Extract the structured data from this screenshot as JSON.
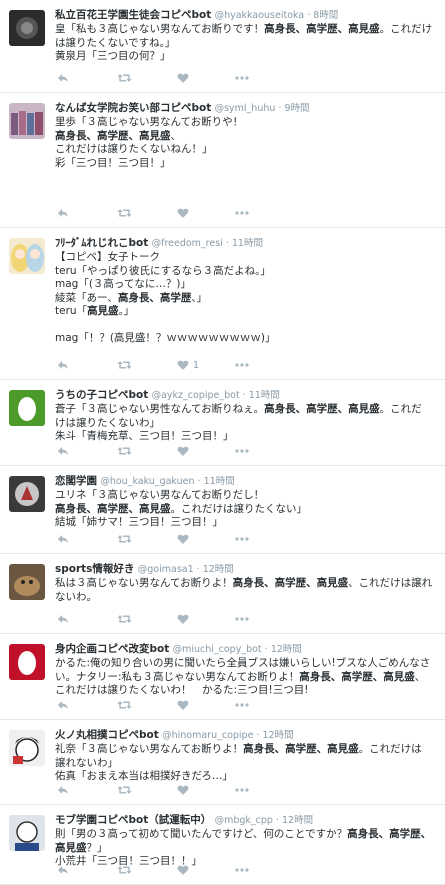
{
  "tweets": [
    {
      "name": "私立百花王学園生徒会コピペbot",
      "handle": "@hyakkaouseitoka",
      "time": "8時間",
      "avatar": "dark-photo",
      "lines": [
        [
          {
            "t": "皇「私も３高じゃない男なんてお断りです！"
          },
          {
            "t": "高身長、高学歴、高見盛",
            "b": true
          },
          {
            "t": "。これだけ"
          }
        ],
        [
          {
            "t": "は譲りたくないですね。」"
          }
        ],
        [
          {
            "t": "黄泉月「三つ目の何？」"
          }
        ]
      ],
      "likes": ""
    },
    {
      "name": "なんば女学院お笑い部コピペbot",
      "handle": "@syml_huhu",
      "time": "9時間",
      "avatar": "group-photo",
      "lines": [
        [
          {
            "t": "里歩「３高じゃない男なんてお断りや！"
          }
        ],
        [
          {
            "t": "高身長、高学歴、高見盛",
            "b": true
          },
          {
            "t": "、"
          }
        ],
        [
          {
            "t": "これだけは譲りたくないねん！」"
          }
        ],
        [
          {
            "t": "彩「三つ目！三つ目！」"
          }
        ]
      ],
      "likes": ""
    },
    {
      "name": "ﾌﾘｰﾀﾞﾑれじれこbot",
      "handle": "@freedom_resi",
      "time": "11時間",
      "avatar": "anime-blonde",
      "lines": [
        [
          {
            "t": "【コピペ】女子トーク"
          }
        ],
        [
          {
            "t": "teru「やっぱり彼氏にするなら３高だよね。」"
          }
        ],
        [
          {
            "t": "mag「(３高ってなに…？)」"
          }
        ],
        [
          {
            "t": "綾菜「あー、"
          },
          {
            "t": "高身長、高学歴",
            "b": true
          },
          {
            "t": "、」"
          }
        ],
        [
          {
            "t": "teru「"
          },
          {
            "t": "高見盛",
            "b": true
          },
          {
            "t": "。」"
          }
        ],
        [
          {
            "t": " "
          }
        ],
        [
          {
            "t": "mag「！？(高見盛！？ｗｗｗｗｗｗｗｗｗ)」"
          }
        ]
      ],
      "likes": "1"
    },
    {
      "name": "うちの子コピペbot",
      "handle": "@aykz_copipe_bot",
      "time": "11時間",
      "avatar": "egg-green",
      "lines": [
        [
          {
            "t": "蒼子「３高じゃない男性なんてお断りねぇ。"
          },
          {
            "t": "高身長、高学歴、高見盛",
            "b": true
          },
          {
            "t": "。これだ"
          }
        ],
        [
          {
            "t": "けは譲りたくないわ」"
          }
        ],
        [
          {
            "t": "朱斗「青梅充草、三つ目！三つ目！」"
          }
        ]
      ],
      "likes": ""
    },
    {
      "name": "恋閣学園",
      "handle": "@hou_kaku_gakuen",
      "time": "11時間",
      "avatar": "emblem",
      "lines": [
        [
          {
            "t": "ユリネ「３高じゃない男なんてお断りだし！"
          }
        ],
        [
          {
            "t": "高身長、高学歴、高見盛",
            "b": true
          },
          {
            "t": "。これだけは譲りたくない」"
          }
        ],
        [
          {
            "t": "結城「姉サマ！三つ目！三つ目！」"
          }
        ]
      ],
      "likes": ""
    },
    {
      "name": "sports情報好き",
      "handle": "@goimasa1",
      "time": "12時間",
      "avatar": "dog-photo",
      "lines": [
        [
          {
            "t": "私は３高じゃない男なんてお断りよ！"
          },
          {
            "t": "高身長、高学歴、高見盛",
            "b": true
          },
          {
            "t": "、これだけは譲れ"
          }
        ],
        [
          {
            "t": "ないわ。"
          }
        ]
      ],
      "likes": ""
    },
    {
      "name": "身内企画コピペ改変bot",
      "handle": "@miuchi_copy_bot",
      "time": "12時間",
      "avatar": "egg-red",
      "lines": [
        [
          {
            "t": "かるた:俺の知り合いの男に聞いたら全員ブスは嫌いらしい!ブスな人ごめんなさ"
          }
        ],
        [
          {
            "t": "い。ナタリー:私も３高じゃない男なんてお断りよ！"
          },
          {
            "t": "高身長、高学歴、高見盛",
            "b": true
          },
          {
            "t": "、"
          }
        ],
        [
          {
            "t": "これだけは譲りたくないわ！　かるた:三つ目!三つ目!"
          }
        ]
      ],
      "likes": ""
    },
    {
      "name": "火ノ丸相撲コピペbot",
      "handle": "@hinomaru_copipe",
      "time": "12時間",
      "avatar": "manga-face",
      "lines": [
        [
          {
            "t": "礼奈「３高じゃない男なんてお断りよ！"
          },
          {
            "t": "高身長、高学歴、高見盛",
            "b": true
          },
          {
            "t": "。これだけは"
          }
        ],
        [
          {
            "t": "譲れないわ」"
          }
        ],
        [
          {
            "t": "佑真「おまえ本当は相撲好きだろ…」"
          }
        ]
      ],
      "likes": ""
    },
    {
      "name": "モブ学園コピペbot（試運転中）",
      "handle": "@mbgk_cpp",
      "time": "12時間",
      "avatar": "mob-manga",
      "lines": [
        [
          {
            "t": "則「男の３高って初めて聞いたんですけど、何のことですか？"
          },
          {
            "t": "高身長、高学歴、",
            "b": true
          }
        ],
        [
          {
            "t": "高見盛",
            "b": true
          },
          {
            "t": "？」"
          }
        ],
        [
          {
            "t": "小荒井「三つ目！三つ目！！」"
          }
        ]
      ],
      "likes": ""
    }
  ]
}
